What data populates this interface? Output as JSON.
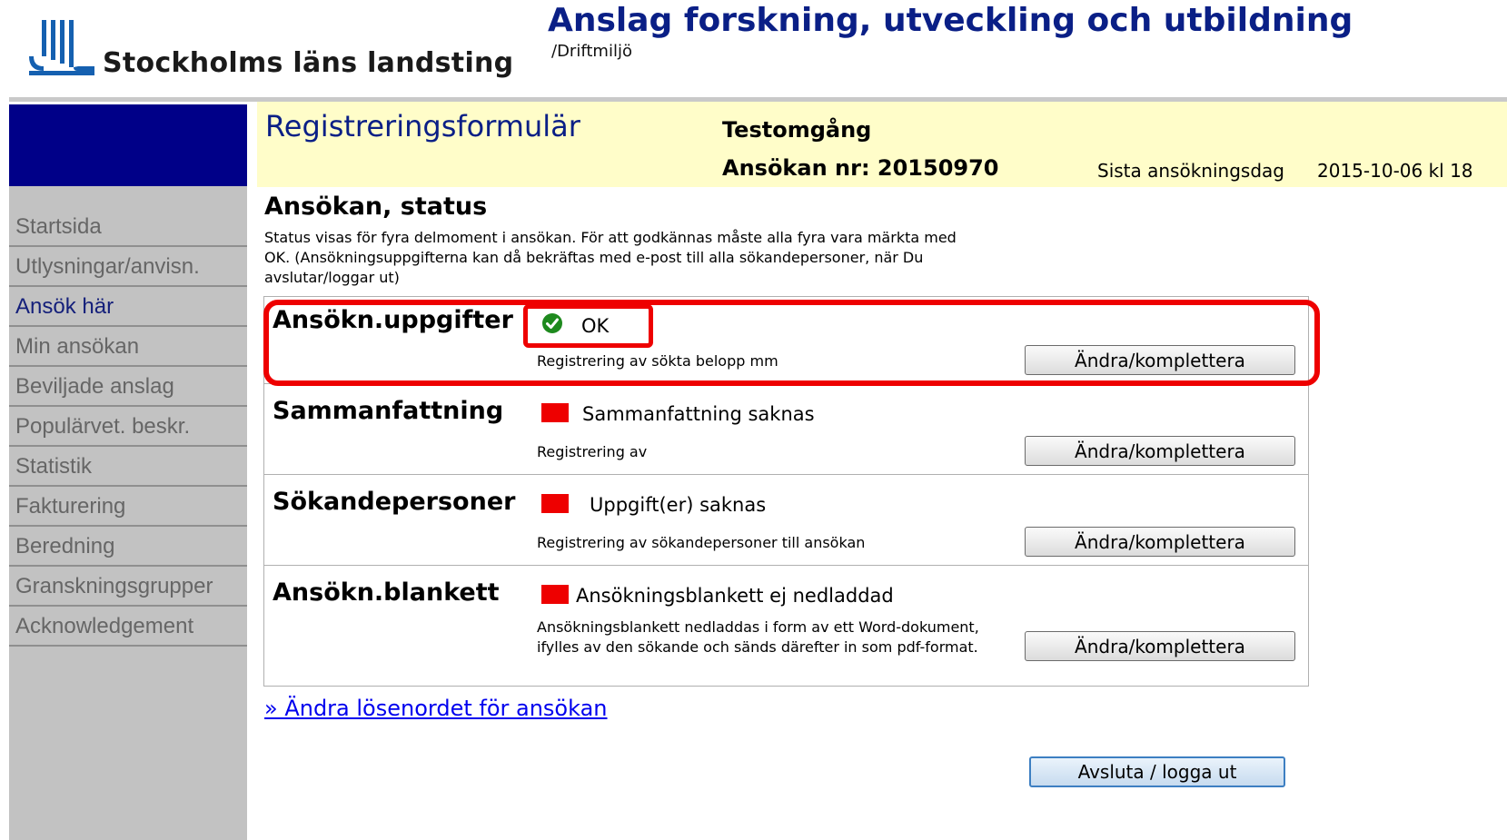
{
  "header": {
    "logo_text": "Stockholms läns landsting",
    "app_title": "Anslag forskning, utveckling och utbildning",
    "environment": "/Driftmiljö"
  },
  "sidebar": {
    "items": [
      {
        "label": "Startsida"
      },
      {
        "label": "Utlysningar/anvisn."
      },
      {
        "label": "Ansök här",
        "active": true
      },
      {
        "label": "Min ansökan"
      },
      {
        "label": "Beviljade anslag"
      },
      {
        "label": "Populärvet. beskr."
      },
      {
        "label": "Statistik"
      },
      {
        "label": "Fakturering"
      },
      {
        "label": "Beredning"
      },
      {
        "label": "Granskningsgrupper"
      },
      {
        "label": "Acknowledgement"
      }
    ]
  },
  "form_header": {
    "title": "Registreringsformulär",
    "round_name": "Testomgång",
    "application_number": "Ansökan nr: 20150970",
    "deadline_label": "Sista ansökningsdag",
    "deadline_value": "2015-10-06 kl 18"
  },
  "status_section": {
    "title": "Ansökan, status",
    "intro": "Status visas för fyra delmoment i ansökan. För att godkännas måste alla fyra vara märkta med OK. (Ansökningsuppgifterna kan då bekräftas med e-post till alla sökandepersoner, när Du avslutar/loggar ut)"
  },
  "rows": [
    {
      "title": "Ansökn.uppgifter",
      "status": "OK",
      "state": "ok",
      "description": "Registrering av sökta belopp mm",
      "button": "Ändra/komplettera"
    },
    {
      "title": "Sammanfattning",
      "status": "Sammanfattning saknas",
      "state": "missing",
      "description": "Registrering av",
      "button": "Ändra/komplettera"
    },
    {
      "title": "Sökandepersoner",
      "status": "Uppgift(er) saknas",
      "state": "missing",
      "description": "Registrering av sökandepersoner till ansökan",
      "button": "Ändra/komplettera"
    },
    {
      "title": "Ansökn.blankett",
      "status": "Ansökningsblankett ej nedladdad",
      "state": "missing",
      "description": "Ansökningsblankett nedladdas i form av ett Word-dokument, ifylles av den sökande och sänds därefter in som pdf-format.",
      "button": "Ändra/komplettera"
    }
  ],
  "links": {
    "change_password": "» Ändra lösenordet för ansökan"
  },
  "actions": {
    "logout": "Avsluta / logga ut"
  },
  "colors": {
    "brand_blue": "#0a1f86",
    "sidebar_top": "#000088",
    "band_yellow": "#fffdc9",
    "missing_red": "#ee0000",
    "ok_green": "#1e8a1e",
    "annotation_red": "#ee0000"
  },
  "icons": {
    "ok": "check-circle-icon",
    "missing": "red-square-icon"
  }
}
